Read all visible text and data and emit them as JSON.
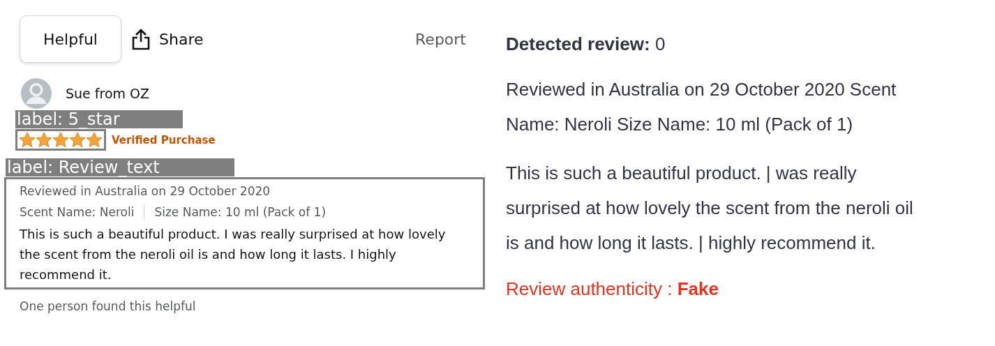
{
  "review_card": {
    "helpful_button": "Helpful",
    "share_button": "Share",
    "report_link": "Report",
    "reviewer": {
      "name": "Sue from OZ"
    },
    "star_label": "label: 5_star",
    "stars": 5,
    "verified": "Verified Purchase",
    "text_label": "label: Review_text",
    "meta": "Reviewed in Australia on 29 October 2020",
    "attributes": [
      "Scent Name: Neroli",
      "Size Name: 10 ml (Pack of 1)"
    ],
    "body": "This is such a beautiful product. I was really surprised at how lovely the scent from the neroli oil is and how long it lasts. I highly recommend it.",
    "helpful_count": "One person found this helpful"
  },
  "result": {
    "detected": "**Detected review:** 0",
    "meta": "Reviewed in Australia on 29 October 2020 Scent Name: Neroli Size Name: 10 ml (Pack of 1)",
    "text": "This is such a beautiful product. | was really surprised at how lovely the scent from the neroli oil is and how long it lasts. | highly recommend it.",
    "authenticity": "Review authenticity : **Fake**"
  }
}
